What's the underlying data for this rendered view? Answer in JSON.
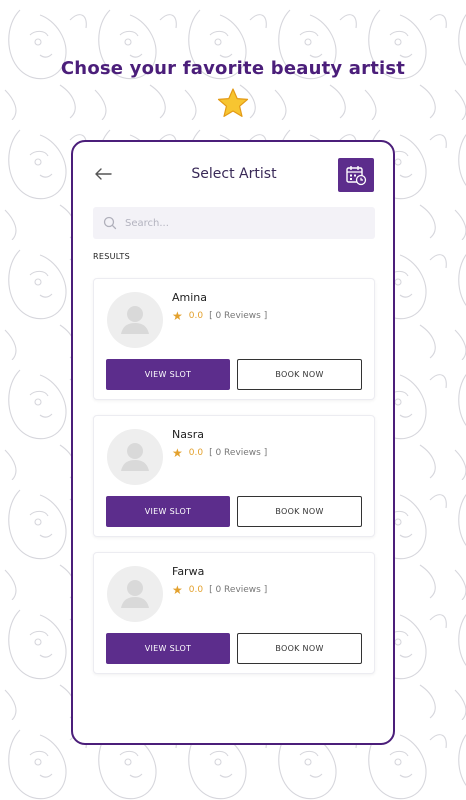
{
  "headline": "Chose your favorite beauty artist",
  "header": {
    "title": "Select Artist"
  },
  "search": {
    "placeholder": "Search..."
  },
  "results_label": "RESULTS",
  "artists": [
    {
      "name": "Amina",
      "rating": "0.0",
      "reviews": "[ 0 Reviews ]"
    },
    {
      "name": "Nasra",
      "rating": "0.0",
      "reviews": "[ 0 Reviews ]"
    },
    {
      "name": "Farwa",
      "rating": "0.0",
      "reviews": "[ 0 Reviews ]"
    }
  ],
  "buttons": {
    "view_slot": "VIEW SLOT",
    "book_now": "BOOK NOW"
  },
  "icons": {
    "back": "arrow-left-icon",
    "calendar": "calendar-icon",
    "search": "search-icon",
    "rating": "star-icon",
    "avatar": "user-placeholder-icon"
  },
  "colors": {
    "brand_purple": "#5c2d8c",
    "headline_purple": "#4b1e7a",
    "star_gold": "#e3a12d"
  }
}
